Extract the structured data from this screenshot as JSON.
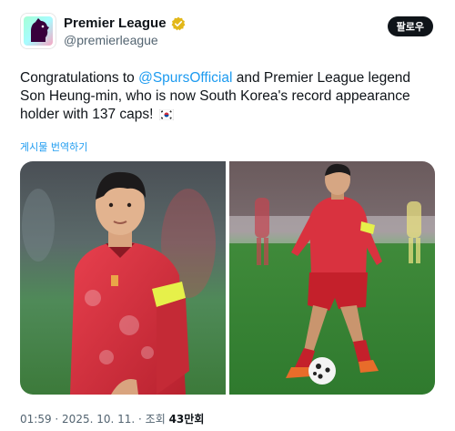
{
  "account": {
    "display_name": "Premier League",
    "handle": "@premierleague",
    "verified_color": "#e2b719"
  },
  "follow_button": {
    "label": "팔로우"
  },
  "tweet": {
    "text_before": "Congratulations to ",
    "mention": "@SpursOfficial",
    "text_after": " and Premier League legend Son Heung-min, who is now South Korea's record appearance holder with 137 caps!",
    "flag_icon": "south-korea-flag-icon"
  },
  "translate_link": "게시물 번역하기",
  "media": {
    "photos": [
      {
        "alt_semantic": "player-portrait-photo"
      },
      {
        "alt_semantic": "player-dribbling-photo"
      }
    ],
    "colors": {
      "kit_red": "#d9323f",
      "pitch_green": "#3f8a3a",
      "shorts_red": "#c4202b"
    }
  },
  "meta": {
    "time": "01:59",
    "separator": " · ",
    "date": "2025. 10. 11.",
    "views_label": "조회",
    "views_count": "43만회"
  }
}
